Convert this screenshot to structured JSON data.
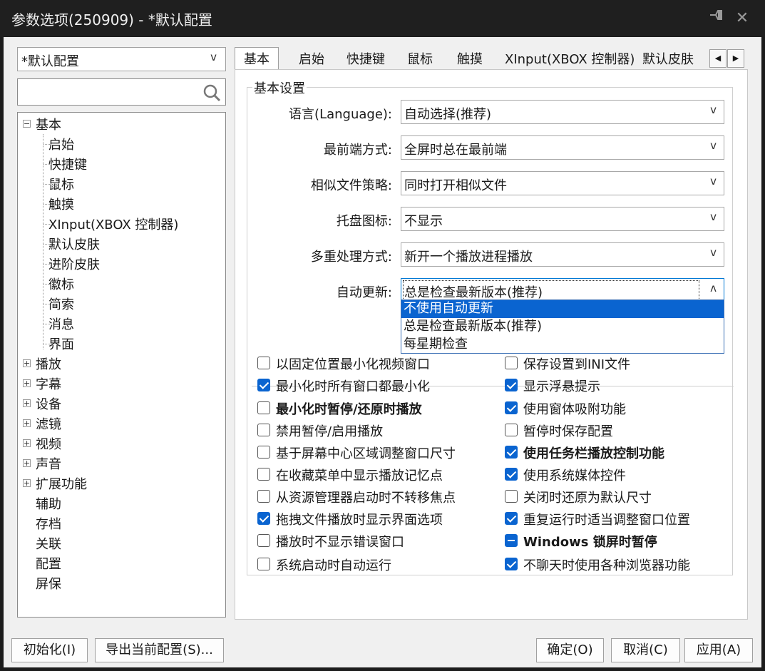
{
  "window": {
    "title": "参数选项(250909) - *默认配置",
    "pin_icon": "pin-icon",
    "close_icon": "close-icon"
  },
  "left": {
    "profile_select": "*默认配置",
    "search_placeholder": "",
    "tree": [
      {
        "label": "基本",
        "expander": "⊟"
      },
      {
        "label": "启始"
      },
      {
        "label": "快捷键"
      },
      {
        "label": "鼠标"
      },
      {
        "label": "触摸"
      },
      {
        "label": "XInput(XBOX 控制器)"
      },
      {
        "label": "默认皮肤"
      },
      {
        "label": "进阶皮肤"
      },
      {
        "label": "徽标"
      },
      {
        "label": "简索"
      },
      {
        "label": "消息"
      },
      {
        "label": "界面"
      },
      {
        "label": "播放",
        "expander": "⊞"
      },
      {
        "label": "字幕",
        "expander": "⊞"
      },
      {
        "label": "设备",
        "expander": "⊞"
      },
      {
        "label": "滤镜",
        "expander": "⊞"
      },
      {
        "label": "视频",
        "expander": "⊞"
      },
      {
        "label": "声音",
        "expander": "⊞"
      },
      {
        "label": "扩展功能",
        "expander": "⊞"
      },
      {
        "label": "辅助"
      },
      {
        "label": "存档"
      },
      {
        "label": "关联"
      },
      {
        "label": "配置"
      },
      {
        "label": "屏保"
      }
    ]
  },
  "tabs": [
    "基本",
    "启始",
    "快捷键",
    "鼠标",
    "触摸",
    "XInput(XBOX 控制器)",
    "默认皮肤"
  ],
  "tab_scroll": {
    "left": "◀",
    "right": "▶"
  },
  "basic": {
    "group_title": "基本设置",
    "rows": [
      {
        "label": "语言(Language):",
        "value": "自动选择(推荐)"
      },
      {
        "label": "最前端方式:",
        "value": "全屏时总在最前端"
      },
      {
        "label": "相似文件策略:",
        "value": "同时打开相似文件"
      },
      {
        "label": "托盘图标:",
        "value": "不显示"
      },
      {
        "label": "多重处理方式:",
        "value": "新开一个播放进程播放"
      },
      {
        "label": "自动更新:",
        "value": "总是检查最新版本(推荐)"
      }
    ],
    "arrows": {
      "down": "v",
      "up": "ʌ"
    },
    "dropdown_options": [
      "不使用自动更新",
      "总是检查最新版本(推荐)",
      "每星期检查"
    ],
    "dropdown_highlighted": 0,
    "left_checks": [
      {
        "label": "以固定位置最小化视频窗口",
        "state": "off"
      },
      {
        "label": "最小化时所有窗口都最小化",
        "state": "on"
      },
      {
        "label": "最小化时暂停/还原时播放",
        "state": "off",
        "bold": true
      },
      {
        "label": "禁用暂停/启用播放",
        "state": "off"
      },
      {
        "label": "基于屏幕中心区域调整窗口尺寸",
        "state": "off"
      },
      {
        "label": "在收藏菜单中显示播放记忆点",
        "state": "off"
      },
      {
        "label": "从资源管理器启动时不转移焦点",
        "state": "off"
      },
      {
        "label": "拖拽文件播放时显示界面选项",
        "state": "on"
      },
      {
        "label": "播放时不显示错误窗口",
        "state": "off"
      },
      {
        "label": "系统启动时自动运行",
        "state": "off"
      }
    ],
    "right_checks": [
      {
        "label": "保存设置到INI文件",
        "state": "off"
      },
      {
        "label": "显示浮悬提示",
        "state": "on"
      },
      {
        "label": "使用窗体吸附功能",
        "state": "on"
      },
      {
        "label": "暂停时保存配置",
        "state": "off"
      },
      {
        "label": "使用任务栏播放控制功能",
        "state": "on",
        "bold": true
      },
      {
        "label": "使用系统媒体控件",
        "state": "on"
      },
      {
        "label": "关闭时还原为默认尺寸",
        "state": "off"
      },
      {
        "label": "重复运行时适当调整窗口位置",
        "state": "on"
      },
      {
        "label": "Windows 锁屏时暂停",
        "state": "mixed",
        "bold": true
      },
      {
        "label": "不聊天时使用各种浏览器功能",
        "state": "on"
      }
    ]
  },
  "buttons": {
    "init": "初始化(I)",
    "export": "导出当前配置(S)...",
    "ok": "确定(O)",
    "cancel": "取消(C)",
    "apply": "应用(A)"
  }
}
